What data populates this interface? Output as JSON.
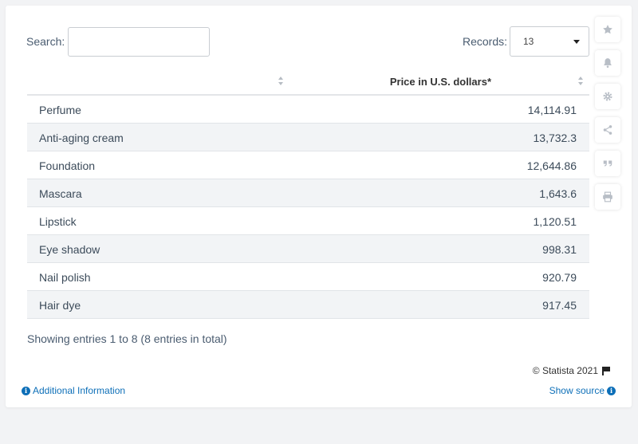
{
  "search": {
    "label": "Search:",
    "value": "",
    "placeholder": ""
  },
  "records": {
    "label": "Records:",
    "value": "13"
  },
  "table": {
    "columns": [
      "",
      "Price in U.S. dollars*"
    ],
    "rows": [
      {
        "name": "Perfume",
        "value": "14,114.91"
      },
      {
        "name": "Anti-aging cream",
        "value": "13,732.3"
      },
      {
        "name": "Foundation",
        "value": "12,644.86"
      },
      {
        "name": "Mascara",
        "value": "1,643.6"
      },
      {
        "name": "Lipstick",
        "value": "1,120.51"
      },
      {
        "name": "Eye shadow",
        "value": "998.31"
      },
      {
        "name": "Nail polish",
        "value": "920.79"
      },
      {
        "name": "Hair dye",
        "value": "917.45"
      }
    ]
  },
  "footer": {
    "showing": "Showing entries 1 to 8 (8 entries in total)",
    "copyright": "© Statista 2021",
    "additional_info": "Additional Information",
    "show_source": "Show source"
  },
  "side_buttons": [
    "star-icon",
    "bell-icon",
    "gear-icon",
    "share-icon",
    "quote-icon",
    "print-icon"
  ],
  "colors": {
    "link": "#0d6fb8",
    "row_alt": "#f2f4f6",
    "icon": "#b8bec6"
  }
}
